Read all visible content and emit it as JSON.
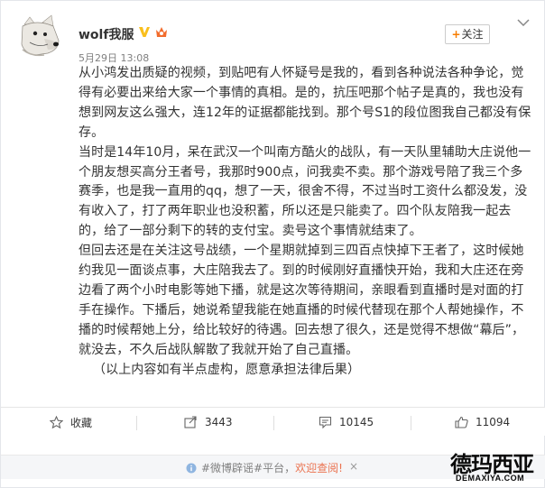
{
  "post": {
    "username": "wolf我服",
    "time": "5月29日 13:08",
    "follow_label": "关注",
    "follow_plus": "+",
    "paragraphs": [
      "从小鸿发出质疑的视频，到贴吧有人怀疑号是我的，看到各种说法各种争论，觉得有必要出来给大家一个事情的真相。是的，抗压吧那个帖子是真的，我也没有想到网友这么强大，连12年的证据都能找到。那个号S1的段位图我自己都没有保存。",
      "当时是14年10月，呆在武汉一个叫南方酷火的战队，有一天队里辅助大庄说他一个朋友想买高分王者号，我那时900点，问我卖不卖。那个游戏号陪了我三个多赛季，也是我一直用的qq，想了一天，很舍不得，不过当时工资什么都没发，没有收入了，打了两年职业也没积蓄，所以还是只能卖了。四个队友陪我一起去的，给了一部分剩下的转的支付宝。卖号这个事情就结束了。",
      "但回去还是在关注这号战绩，一个星期就掉到三四百点快掉下王者了，这时候她约我见一面谈点事，大庄陪我去了。到的时候刚好直播快开始，我和大庄还在旁边看了两个小时电影等她下播，就是这次等待期间，亲眼看到直播时是对面的打手在操作。下播后，她说希望我能在她直播的时候代替现在那个人帮她操作，不播的时候帮她上分，给比较好的待遇。回去想了很久，还是觉得不想做“幕后”，就没去，不久后战队解散了我就开始了自己直播。"
    ],
    "note": "（以上内容如有半点虚构，愿意承担法律后果）"
  },
  "actions": {
    "favorite_label": "收藏",
    "share_count": "3443",
    "comment_count": "10145",
    "like_count": "11094"
  },
  "tip": {
    "text": "#微博辟谣#平台，",
    "link": "欢迎查阅!",
    "close": "×"
  },
  "watermark": {
    "text": "德玛西亚",
    "url": "DEMAXIYA.COM"
  },
  "colors": {
    "accent_orange": "#f77c00",
    "verify_gold": "#f9bf1d",
    "tip_link": "#eb7350"
  }
}
